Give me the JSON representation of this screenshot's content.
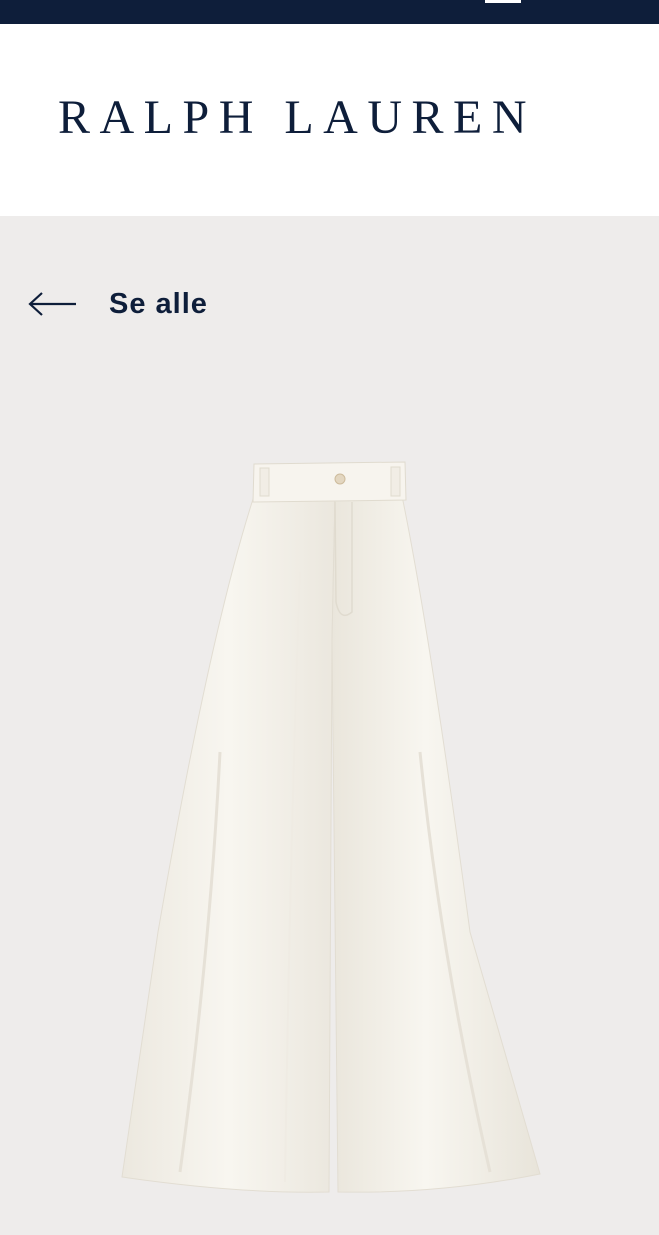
{
  "top_bar": {
    "background_color": "#0e1e3a",
    "active_tab_indicator_color": "#ffffff"
  },
  "header": {
    "brand_name": "RALPH LAUREN",
    "brand_color": "#0e1e3a"
  },
  "navigation": {
    "back_label": "Se alle",
    "back_icon": "arrow-left-icon"
  },
  "product": {
    "image_description_icon": "wide-leg-trousers-image",
    "image_background": "#eeeceb",
    "garment_color": "#f6f3ec"
  }
}
